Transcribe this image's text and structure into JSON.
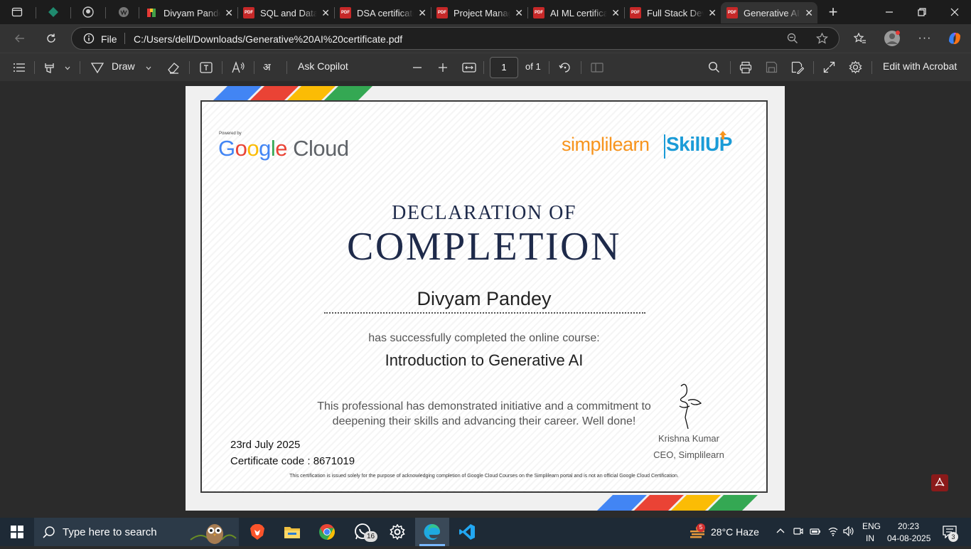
{
  "tabs": [
    {
      "label": "Divyam Pandey",
      "icon": "git-icon"
    },
    {
      "label": "SQL and Data",
      "icon": "pdf-icon"
    },
    {
      "label": "DSA certificate",
      "icon": "pdf-icon"
    },
    {
      "label": "Project Manag",
      "icon": "pdf-icon"
    },
    {
      "label": "AI ML certifica",
      "icon": "pdf-icon"
    },
    {
      "label": "Full Stack Dev",
      "icon": "pdf-icon"
    },
    {
      "label": "Generative AI",
      "icon": "pdf-icon"
    }
  ],
  "address": {
    "scheme_label": "File",
    "url": "C:/Users/dell/Downloads/Generative%20AI%20certificate.pdf"
  },
  "pdf_toolbar": {
    "draw_label": "Draw",
    "ask_copilot": "Ask Copilot",
    "page_number": "1",
    "page_total": "of 1",
    "edit_acrobat": "Edit with Acrobat"
  },
  "certificate": {
    "powered_by": "Powered by",
    "google_cloud": "Cloud",
    "brand_simpli": "simplilearn",
    "brand_skillup": "SkillUP",
    "heading_1": "DECLARATION OF",
    "heading_2": "COMPLETION",
    "recipient": "Divyam Pandey",
    "completed_line": "has successfully completed the online course:",
    "course": "Introduction to Generative AI",
    "praise_1": "This professional has demonstrated initiative and a commitment to",
    "praise_2": "deepening their skills and advancing their career. Well done!",
    "date": "23rd July 2025",
    "cert_code": "Certificate code : 8671019",
    "signer_name": "Krishna Kumar",
    "signer_title": "CEO, Simplilearn",
    "disclaimer": "This certification is issued solely for the purpose of acknowledging completion of Google Cloud Courses on the Simplilearn portal and is not an official Google Cloud Certification.",
    "stripe_colors": [
      "#4285f4",
      "#ea4335",
      "#fbbc05",
      "#34a853"
    ]
  },
  "taskbar": {
    "search_placeholder": "Type here to search",
    "whatsapp_badge": "16",
    "weather_badge": "5",
    "weather": "28°C  Haze",
    "lang_1": "ENG",
    "lang_2": "IN",
    "time": "20:23",
    "date": "04-08-2025",
    "notif_count": "3"
  }
}
